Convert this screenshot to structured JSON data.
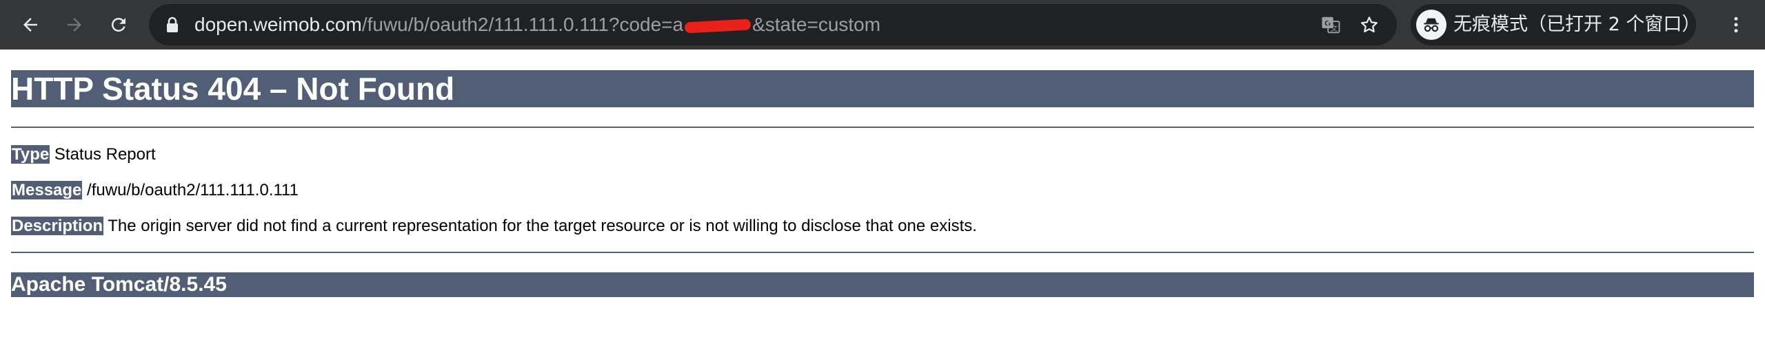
{
  "browser": {
    "back_icon": "arrow-left-icon",
    "forward_icon": "arrow-right-icon",
    "reload_icon": "reload-icon",
    "security_icon": "lock-icon",
    "address": {
      "host": "dopen.weimob.com",
      "path_before_redaction": "/fuwu/b/oauth2/111.111.0.111?code=a",
      "path_after_redaction": "&state=custom"
    },
    "translate_icon": "translate-icon",
    "bookmark_icon": "star-icon",
    "incognito": {
      "icon": "incognito-icon",
      "label": "无痕模式（已打开 2 个窗口）"
    },
    "menu_icon": "more-vertical-icon",
    "colors": {
      "toolbar": "#35363a",
      "omnibox": "#202124",
      "redaction": "#e8221b"
    }
  },
  "page": {
    "heading": "HTTP Status 404 – Not Found",
    "type_label": "Type",
    "type_value": " Status Report",
    "message_label": "Message",
    "message_value": " /fuwu/b/oauth2/111.111.0.111",
    "description_label": "Description",
    "description_value": " The origin server did not find a current representation for the target resource or is not willing to disclose that one exists.",
    "footer": "Apache Tomcat/8.5.45",
    "colors": {
      "bar": "#525d76",
      "bar_text": "#ffffff"
    }
  }
}
